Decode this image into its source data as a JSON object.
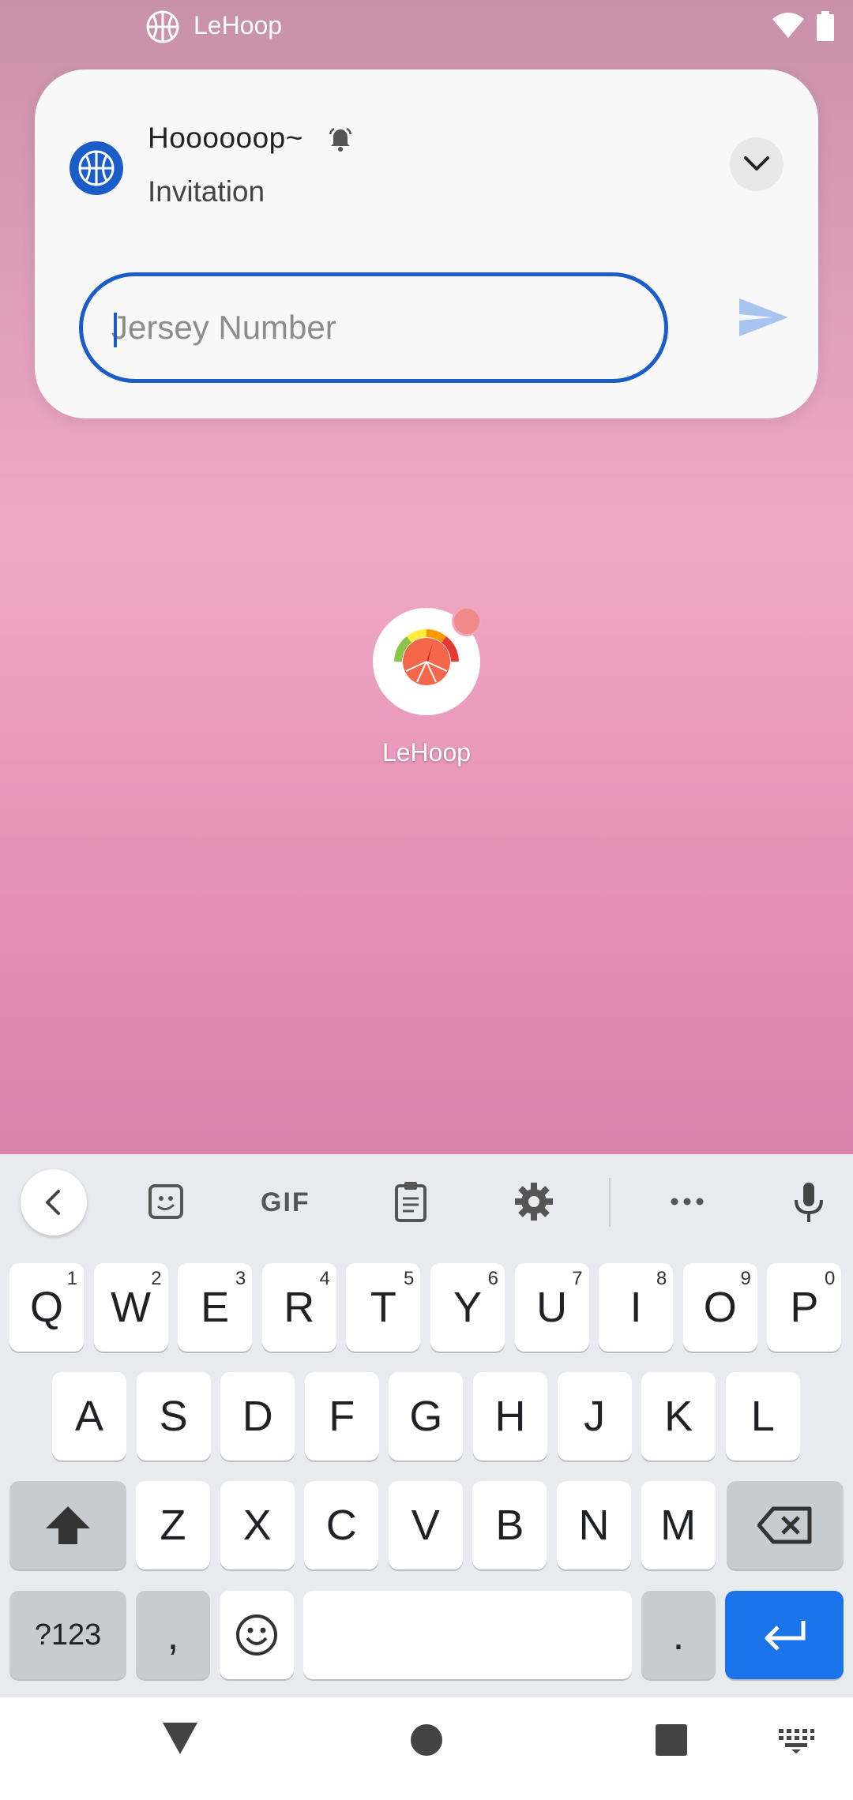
{
  "status_bar": {
    "app_name": "LeHoop",
    "icons": [
      "basketball-icon",
      "wifi-icon",
      "battery-icon"
    ]
  },
  "notification": {
    "title": "Hoooooop~",
    "text": "Invitation",
    "app_icon": "basketball-icon",
    "alert_icon": "bell-icon",
    "expand_icon": "chevron-down-icon",
    "reply": {
      "placeholder": "Jersey Number",
      "value": ""
    },
    "send_icon": "send-icon",
    "accent_color": "#1a5cc8"
  },
  "home": {
    "app_label": "LeHoop",
    "badge_color": "#f08a8a"
  },
  "keyboard": {
    "toolbar": {
      "back_icon": "chevron-left-icon",
      "sticker_icon": "sticker-icon",
      "gif_label": "GIF",
      "clipboard_icon": "clipboard-icon",
      "settings_icon": "gear-icon",
      "more_icon": "more-icon",
      "mic_icon": "microphone-icon"
    },
    "row1": [
      {
        "key": "Q",
        "hint": "1"
      },
      {
        "key": "W",
        "hint": "2"
      },
      {
        "key": "E",
        "hint": "3"
      },
      {
        "key": "R",
        "hint": "4"
      },
      {
        "key": "T",
        "hint": "5"
      },
      {
        "key": "Y",
        "hint": "6"
      },
      {
        "key": "U",
        "hint": "7"
      },
      {
        "key": "I",
        "hint": "8"
      },
      {
        "key": "O",
        "hint": "9"
      },
      {
        "key": "P",
        "hint": "0"
      }
    ],
    "row2": [
      "A",
      "S",
      "D",
      "F",
      "G",
      "H",
      "J",
      "K",
      "L"
    ],
    "row3": [
      "Z",
      "X",
      "C",
      "V",
      "B",
      "N",
      "M"
    ],
    "symbols_label": "?123",
    "comma_label": ",",
    "period_label": ".",
    "enter_color": "#1a73e8"
  },
  "navbar": {
    "icons": [
      "back-triangle-icon",
      "home-circle-icon",
      "recents-square-icon",
      "keyboard-switch-icon"
    ]
  }
}
